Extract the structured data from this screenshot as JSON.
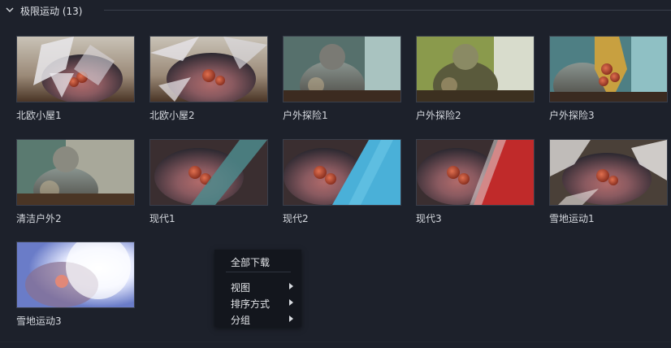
{
  "group": {
    "title": "极限运动 (13)",
    "chevron_icon": "chevron-down-icon"
  },
  "templates": [
    {
      "label": "北欧小屋1",
      "thumbnail": "hands-with-fruit-shard-transition"
    },
    {
      "label": "北欧小屋2",
      "thumbnail": "hands-with-fruit-shard-transition"
    },
    {
      "label": "户外探险1",
      "thumbnail": "person-outdoors-teal-overlay"
    },
    {
      "label": "户外探险2",
      "thumbnail": "person-outdoors-green-overlay"
    },
    {
      "label": "户外探险3",
      "thumbnail": "person-outdoors-fruit-overlay"
    },
    {
      "label": "清洁户外2",
      "thumbnail": "person-outdoors-light-leak"
    },
    {
      "label": "现代1",
      "thumbnail": "hands-with-fruit-teal-stripe"
    },
    {
      "label": "现代2",
      "thumbnail": "hands-with-fruit-blue-stripe"
    },
    {
      "label": "现代3",
      "thumbnail": "hands-with-fruit-red-stripe"
    },
    {
      "label": "雪地运动1",
      "thumbnail": "hands-with-fruit-snow-splash"
    },
    {
      "label": "雪地运动3",
      "thumbnail": "hands-with-fruit-bright-flare"
    }
  ],
  "context_menu": {
    "items": [
      {
        "label": "全部下载",
        "submenu": false
      },
      {
        "label": "视图",
        "submenu": true
      },
      {
        "label": "排序方式",
        "submenu": true
      },
      {
        "label": "分组",
        "submenu": true
      }
    ],
    "submenu_icon": "chevron-right-icon"
  },
  "colors": {
    "background": "#1d212b",
    "menu_background": "#13161d",
    "text": "#d5d8de"
  }
}
